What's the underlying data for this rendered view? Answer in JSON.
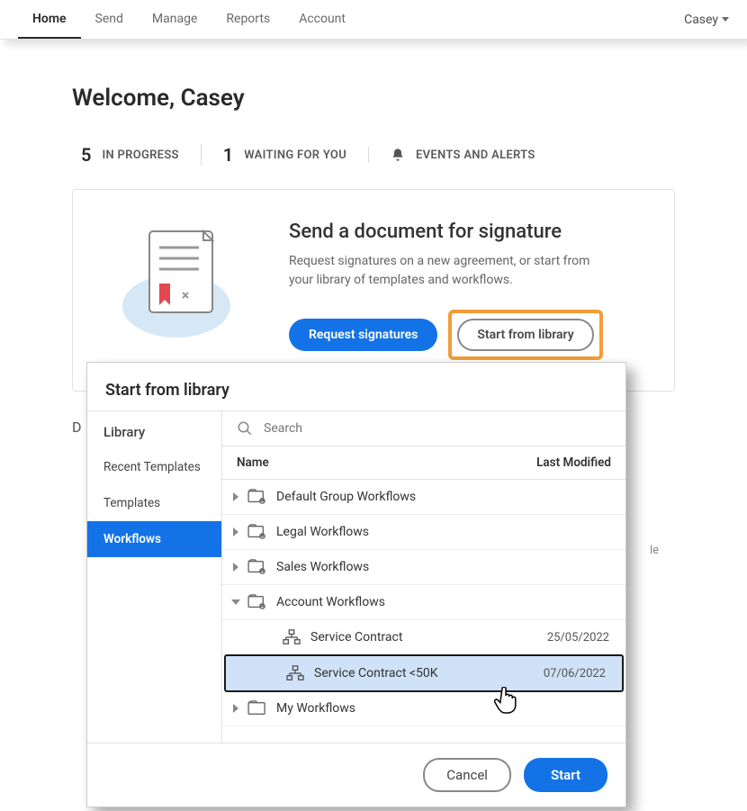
{
  "nav": {
    "items": [
      "Home",
      "Send",
      "Manage",
      "Reports",
      "Account"
    ],
    "user": "Casey"
  },
  "welcome": "Welcome, Casey",
  "stats": {
    "in_progress_count": "5",
    "in_progress_label": "IN PROGRESS",
    "waiting_count": "1",
    "waiting_label": "WAITING FOR YOU",
    "events_label": "EVENTS AND ALERTS"
  },
  "send_card": {
    "title": "Send a document for signature",
    "desc": "Request signatures on a new agreement, or start from your library of templates and workflows.",
    "request_btn": "Request signatures",
    "library_btn": "Start from library"
  },
  "ghost_d": "D",
  "ghost_le": "le",
  "modal": {
    "title": "Start from library",
    "sidebar_title": "Library",
    "sidebar_items": [
      "Recent Templates",
      "Templates",
      "Workflows"
    ],
    "search_placeholder": "Search",
    "col_name": "Name",
    "col_modified": "Last Modified",
    "rows": [
      {
        "label": "Default Group Workflows"
      },
      {
        "label": "Legal Workflows"
      },
      {
        "label": "Sales Workflows"
      },
      {
        "label": "Account Workflows"
      },
      {
        "label": "Service Contract",
        "date": "25/05/2022"
      },
      {
        "label": "Service Contract <50K",
        "date": "07/06/2022"
      },
      {
        "label": "My Workflows"
      }
    ],
    "cancel": "Cancel",
    "start": "Start"
  }
}
